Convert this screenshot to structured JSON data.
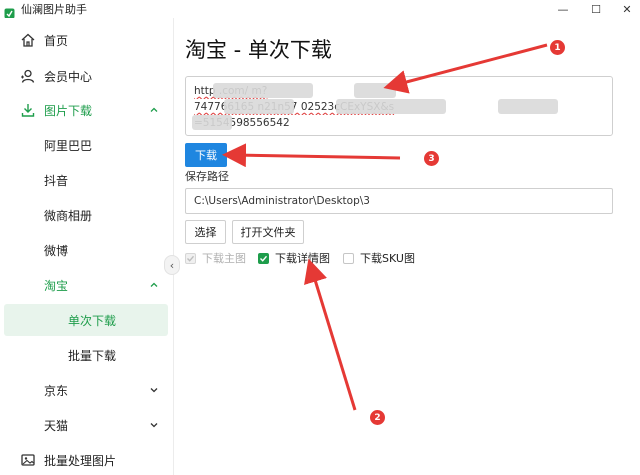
{
  "window": {
    "title": "仙澜图片助手",
    "min_glyph": "—",
    "max_glyph": "☐",
    "close_glyph": "✕"
  },
  "sidebar": {
    "items": [
      {
        "label": "首页",
        "icon": "home-icon"
      },
      {
        "label": "会员中心",
        "icon": "user-icon"
      },
      {
        "label": "图片下载",
        "icon": "download-icon",
        "expanded": true
      },
      {
        "label": "阿里巴巴"
      },
      {
        "label": "抖音"
      },
      {
        "label": "微商相册"
      },
      {
        "label": "微博"
      },
      {
        "label": "淘宝",
        "expanded": true
      },
      {
        "label": "单次下载",
        "selected": true
      },
      {
        "label": "批量下载"
      },
      {
        "label": "京东",
        "expanded": false
      },
      {
        "label": "天猫",
        "expanded": false
      },
      {
        "label": "批量处理图片",
        "icon": "image-icon"
      }
    ],
    "collapse_glyph": "‹"
  },
  "main": {
    "title": "淘宝 - 单次下载",
    "url_lines": [
      "http                    .com/        m?",
      "              747766165                   n21n57               02523cCExYSX&s",
      "        =5154598556542"
    ],
    "download_label": "下载",
    "path_label": "保存路径",
    "path_value": "C:\\Users\\Administrator\\Desktop\\3",
    "choose_label": "选择",
    "open_folder_label": "打开文件夹",
    "checkboxes": {
      "main_image": {
        "label": "下载主图",
        "checked": true,
        "disabled": true
      },
      "detail_image": {
        "label": "下载详情图",
        "checked": true
      },
      "sku_image": {
        "label": "下载SKU图",
        "checked": false
      }
    }
  },
  "annotations": {
    "markers": [
      "1",
      "2",
      "3"
    ],
    "color": "#e53935"
  },
  "colors": {
    "accent_green": "#1e9d4b",
    "button_blue": "#1f86e0"
  }
}
